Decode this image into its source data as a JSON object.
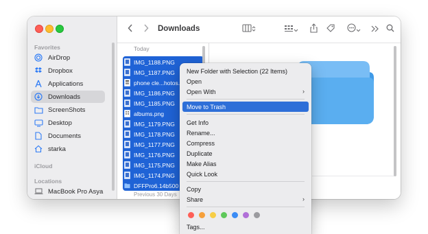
{
  "window": {
    "title": "Downloads"
  },
  "sidebar": {
    "favorites_label": "Favorites",
    "items": [
      {
        "label": "AirDrop",
        "icon": "airdrop-icon"
      },
      {
        "label": "Dropbox",
        "icon": "dropbox-icon"
      },
      {
        "label": "Applications",
        "icon": "applications-icon"
      },
      {
        "label": "Downloads",
        "icon": "downloads-icon",
        "active": true
      },
      {
        "label": "ScreenShots",
        "icon": "folder-icon"
      },
      {
        "label": "Desktop",
        "icon": "desktop-icon"
      },
      {
        "label": "Documents",
        "icon": "document-icon"
      },
      {
        "label": "starka",
        "icon": "home-icon"
      }
    ],
    "icloud_label": "iCloud",
    "locations_label": "Locations",
    "locations": [
      {
        "label": "MacBook Pro Asya",
        "icon": "laptop-icon"
      }
    ]
  },
  "filelist": {
    "today_label": "Today",
    "files": [
      {
        "name": "IMG_1188.PNG",
        "icon": "image-file-icon"
      },
      {
        "name": "IMG_1187.PNG",
        "icon": "image-file-icon"
      },
      {
        "name": "phone cle...hotos.",
        "icon": "image-file-icon"
      },
      {
        "name": "IMG_1186.PNG",
        "icon": "image-file-icon"
      },
      {
        "name": "IMG_1185.PNG",
        "icon": "image-file-icon"
      },
      {
        "name": "albums.png",
        "icon": "image-file-icon"
      },
      {
        "name": "IMG_1179.PNG",
        "icon": "image-file-icon"
      },
      {
        "name": "IMG_1178.PNG",
        "icon": "image-file-icon"
      },
      {
        "name": "IMG_1177.PNG",
        "icon": "image-file-icon"
      },
      {
        "name": "IMG_1176.PNG",
        "icon": "image-file-icon"
      },
      {
        "name": "IMG_1175.PNG",
        "icon": "image-file-icon"
      },
      {
        "name": "IMG_1174.PNG",
        "icon": "image-file-icon"
      },
      {
        "name": "DFFPro6.14b500",
        "icon": "folder-icon"
      }
    ],
    "previous_label": "Previous 30 Days"
  },
  "context_menu": {
    "items": [
      {
        "label": "New Folder with Selection (22 Items)"
      },
      {
        "label": "Open"
      },
      {
        "label": "Open With",
        "submenu": true
      },
      {
        "label": "Move to Trash",
        "highlighted": true
      },
      {
        "label": "Get Info"
      },
      {
        "label": "Rename..."
      },
      {
        "label": "Compress"
      },
      {
        "label": "Duplicate"
      },
      {
        "label": "Make Alias"
      },
      {
        "label": "Quick Look"
      },
      {
        "label": "Copy"
      },
      {
        "label": "Share",
        "submenu": true
      },
      {
        "label": "Tags..."
      }
    ],
    "tag_colors": [
      "#fe5f57",
      "#f6a03b",
      "#f7ce46",
      "#5ec85a",
      "#3b8cf5",
      "#b170d8",
      "#9b9b9f"
    ]
  },
  "colors": {
    "selection": "#1f63d6",
    "highlight": "#2e6fd8"
  }
}
